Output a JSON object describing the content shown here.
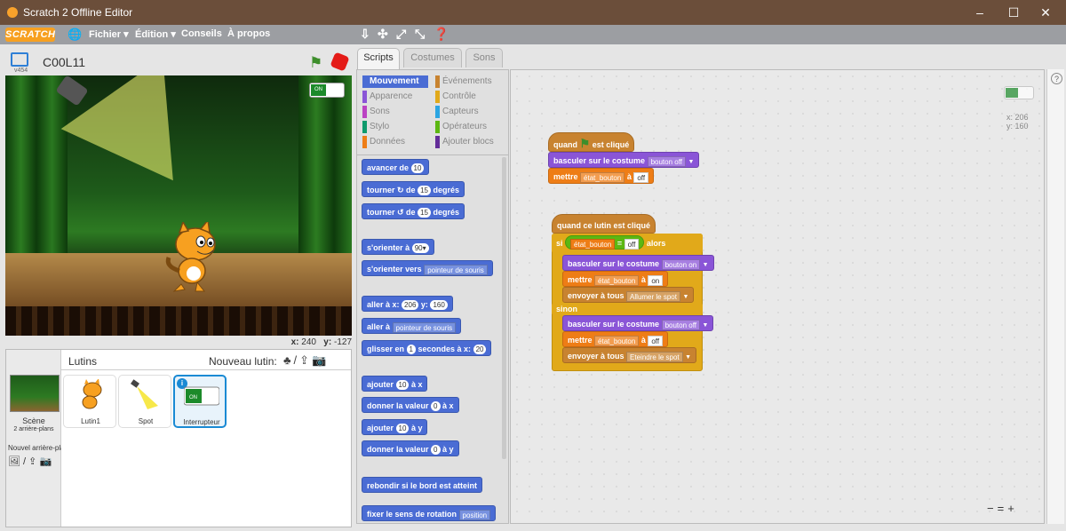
{
  "window": {
    "title": "Scratch 2 Offline Editor",
    "controls": [
      "–",
      "☐",
      "✕"
    ]
  },
  "menu": {
    "logo": "SCRATCH",
    "items": [
      "Fichier ▾",
      "Édition ▾",
      "Conseils",
      "À propos"
    ]
  },
  "stage": {
    "project_name": "C00L11",
    "version": "v454",
    "toggle_label": "ON",
    "coord_x_label": "x:",
    "coord_x": "240",
    "coord_y_label": "y:",
    "coord_y": "-127"
  },
  "sprites": {
    "title": "Lutins",
    "new_sprite": "Nouveau lutin:",
    "scene_label": "Scène",
    "scene_sub": "2 arrière-plans",
    "new_backdrop": "Nouvel arrière-plan:",
    "items": [
      {
        "name": "Lutin1"
      },
      {
        "name": "Spot"
      },
      {
        "name": "Interrupteur",
        "selected": true
      }
    ]
  },
  "tabs": [
    "Scripts",
    "Costumes",
    "Sons"
  ],
  "categories": [
    {
      "label": "Mouvement",
      "color": "#4a6cd4",
      "active": true
    },
    {
      "label": "Apparence",
      "color": "#8a55d7"
    },
    {
      "label": "Sons",
      "color": "#bb42c3"
    },
    {
      "label": "Stylo",
      "color": "#0e9a6c"
    },
    {
      "label": "Données",
      "color": "#ee7d16"
    },
    {
      "label": "Événements",
      "color": "#c88330"
    },
    {
      "label": "Contrôle",
      "color": "#e1a91a"
    },
    {
      "label": "Capteurs",
      "color": "#2ca5e2"
    },
    {
      "label": "Opérateurs",
      "color": "#5cb712"
    },
    {
      "label": "Ajouter blocs",
      "color": "#632d99"
    }
  ],
  "palette": {
    "move": "avancer de",
    "move_val": "10",
    "turn_r": "tourner ↻ de",
    "turn_r_val": "15",
    "degrees": "degrés",
    "turn_l": "tourner ↺ de",
    "turn_l_val": "15",
    "point_dir": "s'orienter à",
    "point_dir_val": "90▾",
    "point_towards": "s'orienter vers",
    "point_towards_val": "pointeur de souris",
    "goto_xy": "aller à x:",
    "goto_x": "206",
    "goto_y_label": "y:",
    "goto_y": "160",
    "goto": "aller à",
    "goto_val": "pointeur de souris",
    "glide": "glisser en",
    "glide_val": "1",
    "glide_rest": "secondes à x:",
    "glide_x": "20",
    "change_x": "ajouter",
    "change_x_val": "10",
    "change_x_rest": "à x",
    "set_x": "donner la valeur",
    "set_x_val": "0",
    "set_x_rest": "à x",
    "change_y": "ajouter",
    "change_y_val": "10",
    "change_y_rest": "à y",
    "set_y": "donner la valeur",
    "set_y_val": "0",
    "set_y_rest": "à y",
    "bounce": "rebondir si le bord est atteint",
    "rotation": "fixer le sens de rotation",
    "rotation_val": "position"
  },
  "script_area": {
    "x_label": "x: 206",
    "y_label": "y: 160",
    "zoom": [
      "−",
      "=",
      "+"
    ],
    "script1": {
      "hat_when": "quand",
      "hat_clicked": "est cliqué",
      "switch_costume": "basculer sur le costume",
      "costume1": "bouton off",
      "set": "mettre",
      "var": "état_bouton",
      "to": "à",
      "val1": "off"
    },
    "script2": {
      "hat": "quand ce lutin est cliqué",
      "if": "si",
      "cond_var": "état_bouton",
      "eq": "=",
      "cond_val": "off",
      "then": "alors",
      "costume_on": "bouton on",
      "set_on": "on",
      "broadcast": "envoyer à tous",
      "msg_on": "Allumer le spot",
      "else": "sinon",
      "costume_off": "bouton off",
      "set_off": "off",
      "msg_off": "Eteindre le spot"
    }
  }
}
